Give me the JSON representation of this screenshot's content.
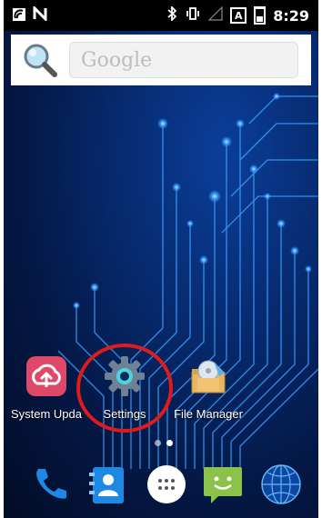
{
  "status_bar": {
    "time": "8:29",
    "lte_label": "A"
  },
  "search": {
    "placeholder": "Google"
  },
  "apps": [
    {
      "label": "System Upda",
      "icon": "cloud-upload-icon"
    },
    {
      "label": "Settings",
      "icon": "gear-icon"
    },
    {
      "label": "File Manager",
      "icon": "file-manager-icon"
    }
  ],
  "page_indicator": {
    "pages": 2,
    "active": 2
  },
  "dock": [
    {
      "icon": "phone-icon"
    },
    {
      "icon": "contacts-icon"
    },
    {
      "icon": "app-drawer-icon"
    },
    {
      "icon": "messaging-icon"
    },
    {
      "icon": "browser-globe-icon"
    }
  ],
  "colors": {
    "highlight": "#e01b1b",
    "background": "#072a6e",
    "circuit": "#3aa0ff"
  }
}
